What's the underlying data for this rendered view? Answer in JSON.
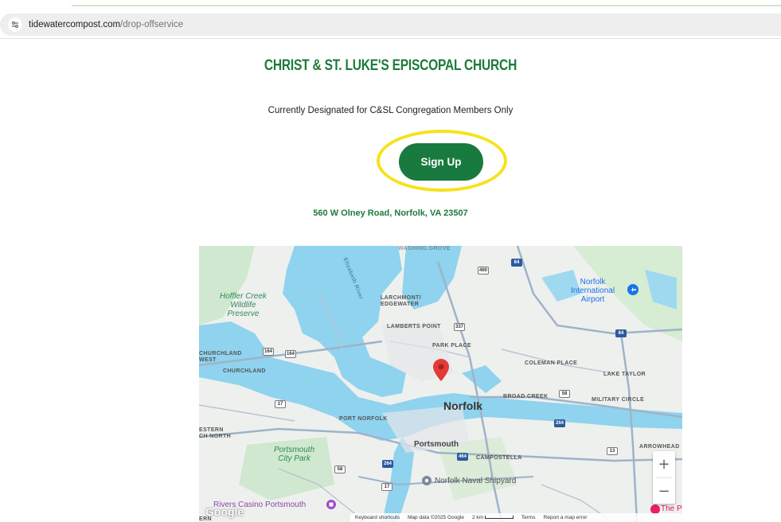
{
  "browser": {
    "url_domain": "tidewatercompost.com",
    "url_path": "/drop-offservice"
  },
  "content": {
    "title": "CHRIST & ST. LUKE'S EPISCOPAL CHURCH",
    "subtitle": "Currently Designated for C&SL Congregation Members Only",
    "signup_label": "Sign Up",
    "address": "560 W Olney Road, Norfolk, VA 23507"
  },
  "map": {
    "labels": {
      "hoffler": "Hoffler Creek\nWildlife\nPreserve",
      "elizabeth_river": "Elizabeth River",
      "larchmont": "LARCHMONT/\nEDGEWATER",
      "lamberts_point": "LAMBERTS POINT",
      "park_place": "PARK PLACE",
      "churchland_west": "CHURCHLAND\nWEST",
      "churchland": "CHURCHLAND",
      "coleman_place": "COLEMAN PLACE",
      "lake_taylor": "LAKE TAYLOR",
      "broad_creek": "BROAD CREEK",
      "military_circle": "MILITARY CIRCLE",
      "norfolk": "Norfolk",
      "port_norfolk": "PORT NORFOLK",
      "western_branch": "ESTERN\nCH NORTH",
      "portsmouth": "Portsmouth",
      "portsmouth_city_park": "Portsmouth\nCity Park",
      "campostella": "CAMPOSTELLA",
      "arrowhead": "ARROWHEAD",
      "naval_shipyard": "Norfolk Naval Shipyard",
      "airport": "Norfolk\nInternational\nAirport",
      "rivers_casino": "Rivers Casino Portsmouth",
      "the_p": "The P",
      "ern": "ERN",
      "washington": "WASHING.GROVE"
    },
    "shields": {
      "r460": "460",
      "r64a": "64",
      "r164a": "164",
      "r164b": "164",
      "r17": "17",
      "r58": "58",
      "r264a": "264",
      "r264b": "264",
      "r464": "464",
      "r13": "13",
      "r64b": "64",
      "r337": "337",
      "r17b": "17",
      "r58b": "58"
    },
    "zoom_in": "+",
    "zoom_out": "−",
    "google_logo": "Google",
    "attribution": {
      "shortcuts": "Keyboard shortcuts",
      "map_data": "Map data ©2025 Google",
      "scale": "2 km",
      "terms": "Terms",
      "report": "Report a map error"
    }
  },
  "colors": {
    "brand_green": "#1e7a3c",
    "button_green": "#187a3e",
    "highlight_yellow": "#f6e21a",
    "water": "#8fd3ee",
    "pin_red": "#e53935"
  }
}
